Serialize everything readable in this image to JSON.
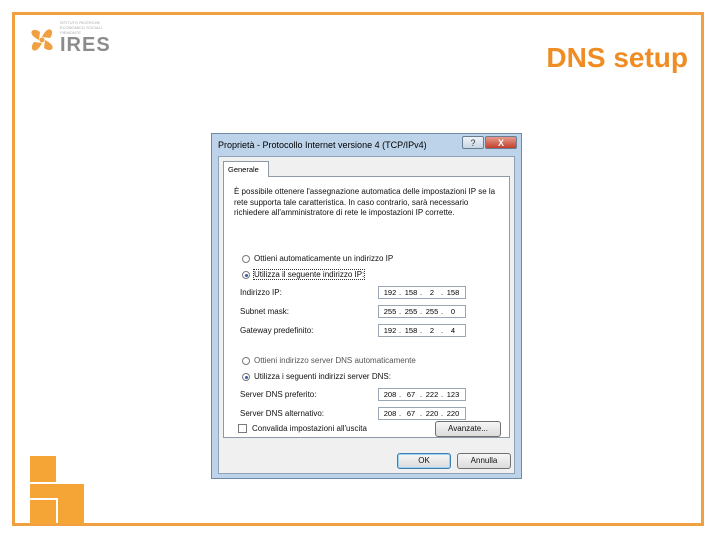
{
  "slide": {
    "title": "DNS setup",
    "logo_text": "IRES",
    "logo_subtitle": "ISTITUTO RICERCHE ECONOMICO SOCIALI PIEMONTE",
    "accent_color": "#ef8d24"
  },
  "dialog": {
    "title": "Proprietà - Protocollo Internet versione 4 (TCP/IPv4)",
    "help_label": "?",
    "close_label": "X",
    "tab_label": "Generale",
    "description": "È possibile ottenere l'assegnazione automatica delle impostazioni IP se la rete supporta tale caratteristica. In caso contrario, sarà necessario richiedere all'amministratore di rete le impostazioni IP corrette.",
    "ip_auto_label": "Ottieni automaticamente un indirizzo IP",
    "ip_manual_label": "Utilizza il seguente indirizzo IP:",
    "ip_fields": [
      {
        "label": "Indirizzo IP:",
        "octets": [
          "192",
          "158",
          "2",
          "158"
        ]
      },
      {
        "label": "Subnet mask:",
        "octets": [
          "255",
          "255",
          "255",
          "0"
        ]
      },
      {
        "label": "Gateway predefinito:",
        "octets": [
          "192",
          "158",
          "2",
          "4"
        ]
      }
    ],
    "dns_auto_label": "Ottieni indirizzo server DNS automaticamente",
    "dns_manual_label": "Utilizza i seguenti indirizzi server DNS:",
    "dns_fields": [
      {
        "label": "Server DNS preferito:",
        "octets": [
          "208",
          "67",
          "222",
          "123"
        ]
      },
      {
        "label": "Server DNS alternativo:",
        "octets": [
          "208",
          "67",
          "220",
          "220"
        ]
      }
    ],
    "validate_label": "Convalida impostazioni all'uscita",
    "advanced_label": "Avanzate...",
    "ok_label": "OK",
    "cancel_label": "Annulla"
  }
}
